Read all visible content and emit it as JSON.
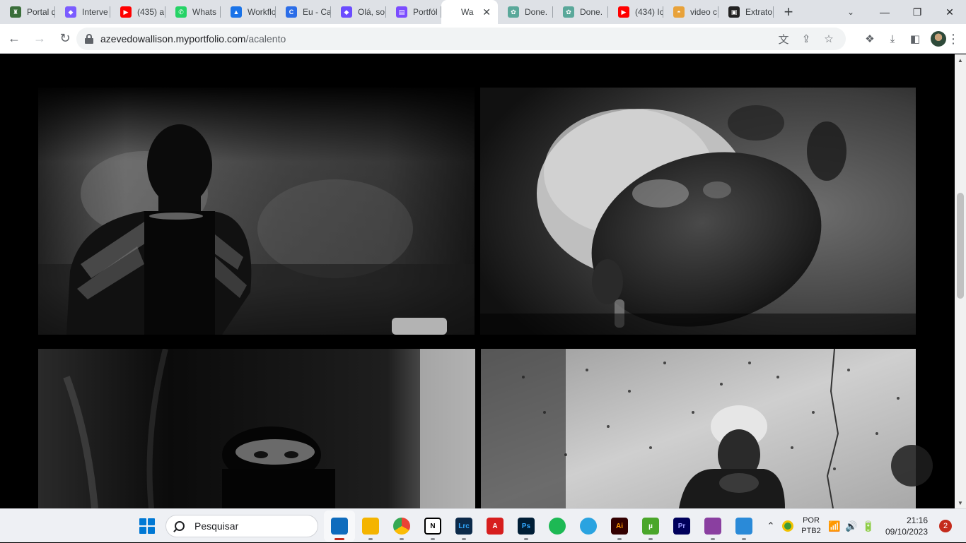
{
  "browser": {
    "tabs": [
      {
        "title": "Portal d",
        "favicon_color": "#3a6e3a",
        "favicon_glyph": "♜"
      },
      {
        "title": "Interve",
        "favicon_color": "#7b5cff",
        "favicon_glyph": "◆"
      },
      {
        "title": "(435) a",
        "favicon_color": "#ff0000",
        "favicon_glyph": "▶"
      },
      {
        "title": "Whats",
        "favicon_color": "#25d366",
        "favicon_glyph": "✆"
      },
      {
        "title": "Workflo",
        "favicon_color": "#1a73e8",
        "favicon_glyph": "▲"
      },
      {
        "title": "Eu - Ca",
        "favicon_color": "#2b6de8",
        "favicon_glyph": "C"
      },
      {
        "title": "Olá, so",
        "favicon_color": "#6b4cff",
        "favicon_glyph": "◆"
      },
      {
        "title": "Portfól",
        "favicon_color": "#7b4cff",
        "favicon_glyph": "▤"
      },
      {
        "title": "Wa",
        "favicon_color": "#ffffff",
        "favicon_glyph": "",
        "active": true
      },
      {
        "title": "Done.",
        "favicon_color": "#5aa89a",
        "favicon_glyph": "✿"
      },
      {
        "title": "Done.",
        "favicon_color": "#5aa89a",
        "favicon_glyph": "✿"
      },
      {
        "title": "(434) Ic",
        "favicon_color": "#ff0000",
        "favicon_glyph": "▶"
      },
      {
        "title": "video c",
        "favicon_color": "#e8a23a",
        "favicon_glyph": "◓"
      },
      {
        "title": "Extrato",
        "favicon_color": "#222222",
        "favicon_glyph": "▣"
      }
    ],
    "new_tab_glyph": "+",
    "url_host": "azevedowallison.myportfolio.com",
    "url_path": "/acalento"
  },
  "page": {
    "photos": [
      {
        "subject": "figure in black hood with feathered wings against wall"
      },
      {
        "subject": "face with glitter and curly blonde hair looking up"
      },
      {
        "subject": "hooded figure with visible eyes"
      },
      {
        "subject": "person with blonde hair seated against spotted wall"
      }
    ]
  },
  "taskbar": {
    "search_placeholder": "Pesquisar",
    "apps": [
      {
        "name": "microsoft-store",
        "label": "",
        "color": "#0f6cbd",
        "state": "focused"
      },
      {
        "name": "file-explorer",
        "label": "",
        "color": "#f4b400",
        "state": "running"
      },
      {
        "name": "chrome",
        "label": "",
        "color": "#ea4335",
        "state": "running"
      },
      {
        "name": "notion",
        "label": "N",
        "color": "#ffffff",
        "state": "running"
      },
      {
        "name": "lightroom-classic",
        "label": "Lrc",
        "color": "#0c2a4a",
        "state": "running"
      },
      {
        "name": "acrobat",
        "label": "A",
        "color": "#d71e1e",
        "state": "none"
      },
      {
        "name": "photoshop",
        "label": "Ps",
        "color": "#001e36",
        "state": "running"
      },
      {
        "name": "spotify",
        "label": "",
        "color": "#1db954",
        "state": "none"
      },
      {
        "name": "telegram",
        "label": "",
        "color": "#2aa3e0",
        "state": "none"
      },
      {
        "name": "illustrator",
        "label": "Ai",
        "color": "#330000",
        "state": "running"
      },
      {
        "name": "utorrent",
        "label": "µ",
        "color": "#4aa62a",
        "state": "running"
      },
      {
        "name": "premiere",
        "label": "Pr",
        "color": "#00005b",
        "state": "none"
      },
      {
        "name": "winrar",
        "label": "",
        "color": "#8a3fa0",
        "state": "running"
      },
      {
        "name": "photos",
        "label": "",
        "color": "#2a8ad8",
        "state": "running"
      }
    ],
    "language": "POR",
    "keyboard": "PTB2",
    "time": "21:16",
    "date": "09/10/2023",
    "notifications": "2"
  }
}
